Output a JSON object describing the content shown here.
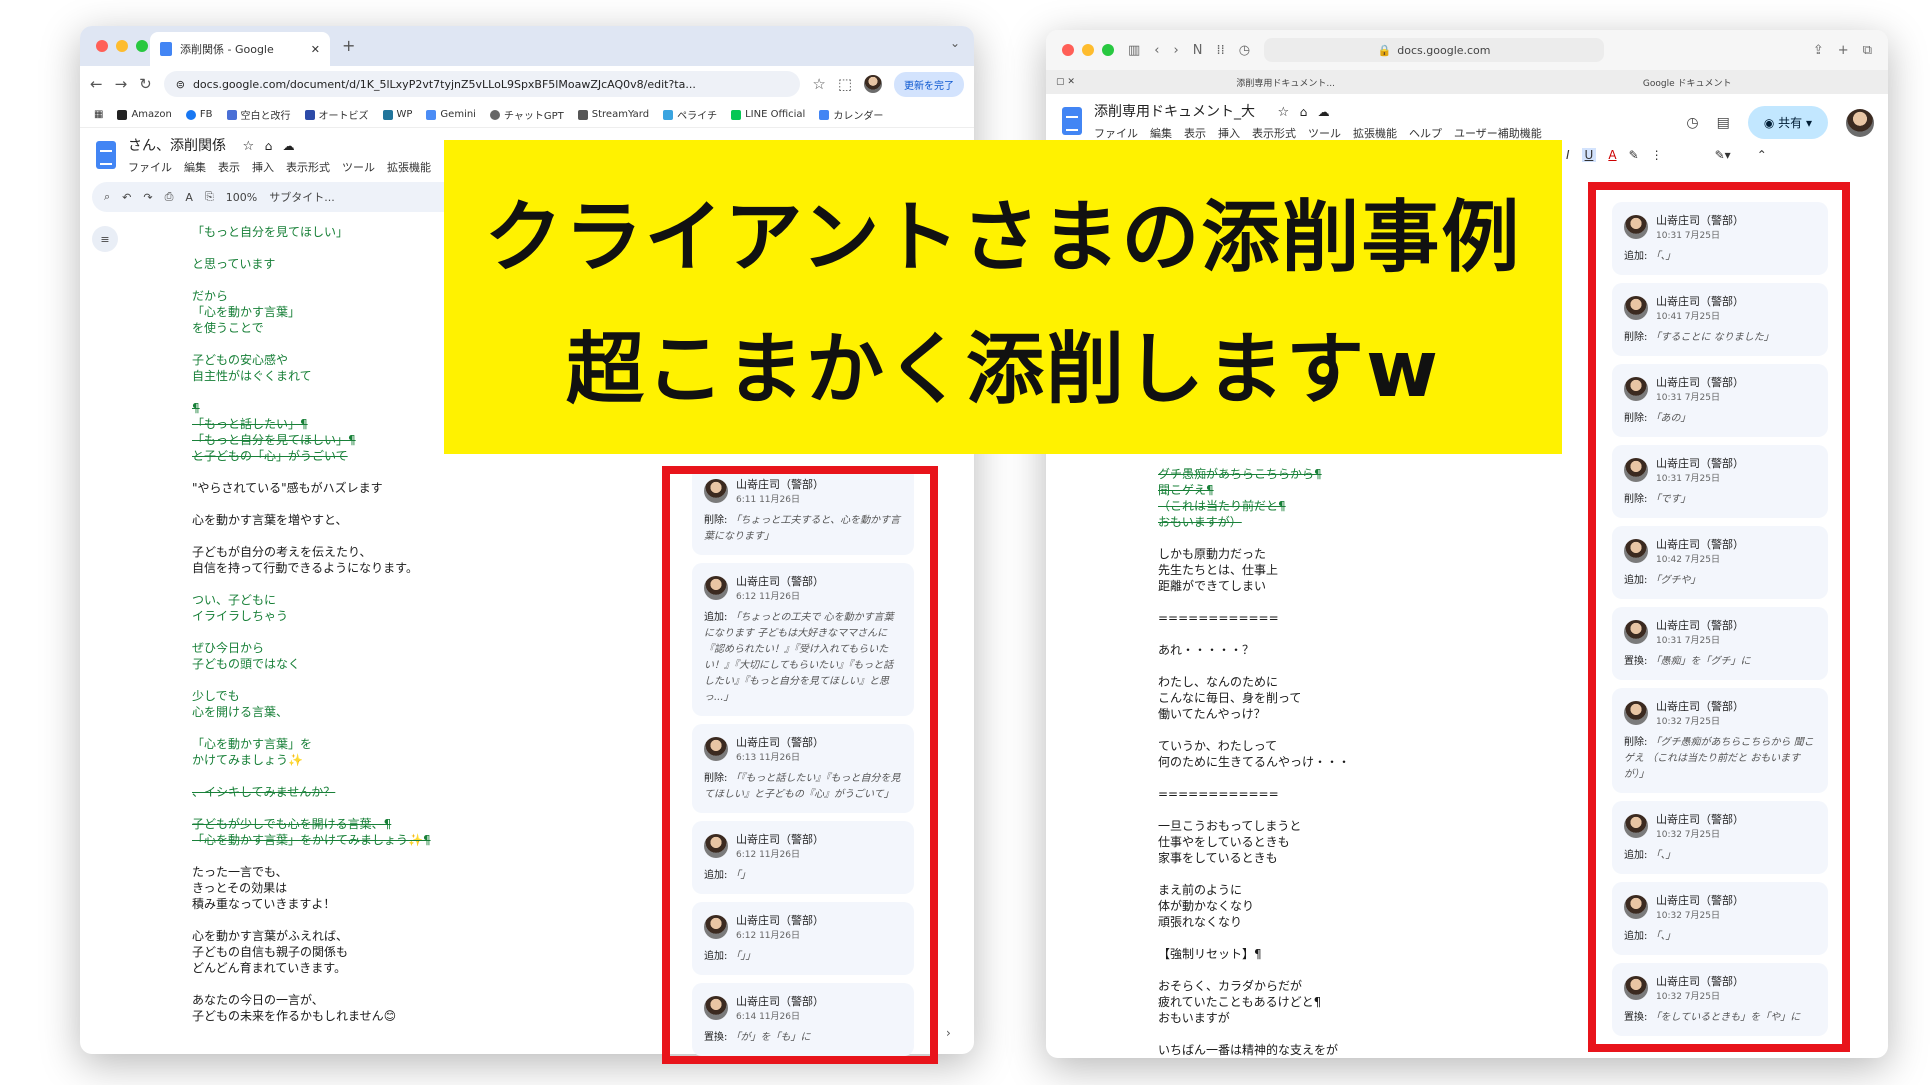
{
  "banner": {
    "line1": "クライアントさまの添削事例",
    "line2": "超こまかく添削しますw"
  },
  "left": {
    "tab_title": "添削関係 - Google",
    "url": "docs.google.com/document/d/1K_5lLxyP2vt7tyjnZ5vLLoL9SpxBF5lMoawZJcAQ0v8/edit?ta...",
    "update_label": "更新を完了",
    "bookmarks": [
      "Amazon",
      "FB",
      "空白と改行",
      "オートビズ",
      "WP",
      "Gemini",
      "チャットGPT",
      "StreamYard",
      "ペライチ",
      "LINE Official",
      "カレンダー"
    ],
    "doc_title": "さん、添削関係",
    "menu": [
      "ファイル",
      "編集",
      "表示",
      "挿入",
      "表示形式",
      "ツール",
      "拡張機能"
    ],
    "zoom": "100%",
    "style": "サブタイト...",
    "paragraphs": [
      {
        "text": "「もっと自分を見てほしい」",
        "cls": "g"
      },
      {
        "text": "と思っています",
        "cls": "g"
      },
      {
        "text": "だから\n「心を動かす言葉」\nを使うことで",
        "cls": "g"
      },
      {
        "text": "子どもの安心感や\n自主性がはぐくまれて",
        "cls": "g"
      },
      {
        "text": "¶\n「もっと話したい」¶\n「もっと自分を見てほしい」¶\nと子どもの「心」がうごいて",
        "cls": "strike"
      },
      {
        "text": "\"やらされている\"感もがハズレます",
        "cls": ""
      },
      {
        "text": "心を動かす言葉を増やすと、",
        "cls": ""
      },
      {
        "text": "子どもが自分の考えを伝えたり、\n自信を持って行動できるようになります。",
        "cls": ""
      },
      {
        "text": "つい、子どもに\nイライラしちゃう",
        "cls": "g"
      },
      {
        "text": "ぜひ今日から\n子どもの頭ではなく",
        "cls": "g"
      },
      {
        "text": "少しでも\n心を開ける言葉、",
        "cls": "g"
      },
      {
        "text": "「心を動かす言葉」を\nかけてみましょう✨",
        "cls": "g"
      },
      {
        "text": "、イシキしてみませんか？",
        "cls": "strike"
      },
      {
        "text": "子どもが少しでも心を開ける言葉、¶\n「心を動かす言葉」をかけてみましょう✨¶",
        "cls": "strike"
      },
      {
        "text": "たった一言でも、\nきっとその効果は\n積み重なっていきますよ！",
        "cls": ""
      },
      {
        "text": "心を動かす言葉がふえれば、\n子どもの自信も親子の関係も\nどんどん育まれていきます。",
        "cls": ""
      },
      {
        "text": "あなたの今日の一言が、\n子どもの未来を作るかもしれません😊",
        "cls": ""
      }
    ],
    "comments": [
      {
        "name": "山嵜庄司（警部）",
        "time": "6:11 11月26日",
        "action": "削除:",
        "body": "「ちょっと工夫すると、心を動かす言葉になります」"
      },
      {
        "name": "山嵜庄司（警部）",
        "time": "6:12 11月26日",
        "action": "追加:",
        "body": "「ちょっとの工夫で 心を動かす言葉になります 子どもは大好きなママさんに『認められたい！』『受け入れてもらいたい！』『大切にしてもらいたい』『もっと話したい』『もっと自分を見てほしい』と思っ...」"
      },
      {
        "name": "山嵜庄司（警部）",
        "time": "6:13 11月26日",
        "action": "削除:",
        "body": "「『もっと話したい』『もっと自分を見てほしい』と子どもの『心』がうごいて」"
      },
      {
        "name": "山嵜庄司（警部）",
        "time": "6:12 11月26日",
        "action": "追加:",
        "body": "「」"
      },
      {
        "name": "山嵜庄司（警部）",
        "time": "6:12 11月26日",
        "action": "追加:",
        "body": "「」」"
      },
      {
        "name": "山嵜庄司（警部）",
        "time": "6:14 11月26日",
        "action": "置換:",
        "body": "「が」を「も」に"
      }
    ]
  },
  "right": {
    "url": "docs.google.com",
    "tab1": "添削専用ドキュメント...",
    "tab2": "Google ドキュメント",
    "doc_title": "添削専用ドキュメント_大",
    "menu": [
      "ファイル",
      "編集",
      "表示",
      "挿入",
      "表示形式",
      "ツール",
      "拡張機能",
      "ヘルプ",
      "ユーザー補助機能"
    ],
    "share": "共有",
    "paragraphs": [
      {
        "text": "グチ愚痴があちらこちらから¶\n聞こゲえ¶\n（これは当たり前だと¶\nおもいますが）",
        "cls": "strike"
      },
      {
        "text": "しかも原動力だった\n先生たちとは、仕事上\n距離ができてしまい",
        "cls": ""
      },
      {
        "text": "============",
        "cls": ""
      },
      {
        "text": "あれ・・・・・？",
        "cls": ""
      },
      {
        "text": "わたし、なんのために\nこんなに毎日、身を削って\n働いてたんやっけ？",
        "cls": ""
      },
      {
        "text": "ていうか、わたしって\n何のために生きてるんやっけ・・・",
        "cls": ""
      },
      {
        "text": "============",
        "cls": ""
      },
      {
        "text": "一旦こうおもってしまうと\n仕事やをしているときも\n家事をしているときも",
        "cls": ""
      },
      {
        "text": "まえ前のように\n体が動かなくなり\n頑張れなくなり",
        "cls": ""
      },
      {
        "text": "【強制リセット】¶",
        "cls": ""
      },
      {
        "text": "おそらく、カラダからだが\n疲れていたこともあるけどと¶\nおもいますが",
        "cls": ""
      },
      {
        "text": "いちばん一番は精神的な支えをが",
        "cls": ""
      }
    ],
    "comments": [
      {
        "name": "山嵜庄司（警部）",
        "time": "10:31 7月25日",
        "action": "追加:",
        "body": "「、」"
      },
      {
        "name": "山嵜庄司（警部）",
        "time": "10:41 7月25日",
        "action": "削除:",
        "body": "「することに なりました」"
      },
      {
        "name": "山嵜庄司（警部）",
        "time": "10:31 7月25日",
        "action": "削除:",
        "body": "「あの」"
      },
      {
        "name": "山嵜庄司（警部）",
        "time": "10:31 7月25日",
        "action": "削除:",
        "body": "「です」"
      },
      {
        "name": "山嵜庄司（警部）",
        "time": "10:42 7月25日",
        "action": "追加:",
        "body": "「グチや」"
      },
      {
        "name": "山嵜庄司（警部）",
        "time": "10:31 7月25日",
        "action": "置換:",
        "body": "「愚痴」を「グチ」に"
      },
      {
        "name": "山嵜庄司（警部）",
        "time": "10:32 7月25日",
        "action": "削除:",
        "body": "「グチ愚痴があちらこちらから 聞こゲえ （これは当たり前だと おもいますが）」"
      },
      {
        "name": "山嵜庄司（警部）",
        "time": "10:32 7月25日",
        "action": "追加:",
        "body": "「、」"
      },
      {
        "name": "山嵜庄司（警部）",
        "time": "10:32 7月25日",
        "action": "追加:",
        "body": "「、」"
      },
      {
        "name": "山嵜庄司（警部）",
        "time": "10:32 7月25日",
        "action": "置換:",
        "body": "「をしているときも」を「や」に"
      }
    ]
  },
  "colors": {
    "highlight": "#fff200",
    "redbox": "#e8141b",
    "suggestion": "#188038"
  }
}
